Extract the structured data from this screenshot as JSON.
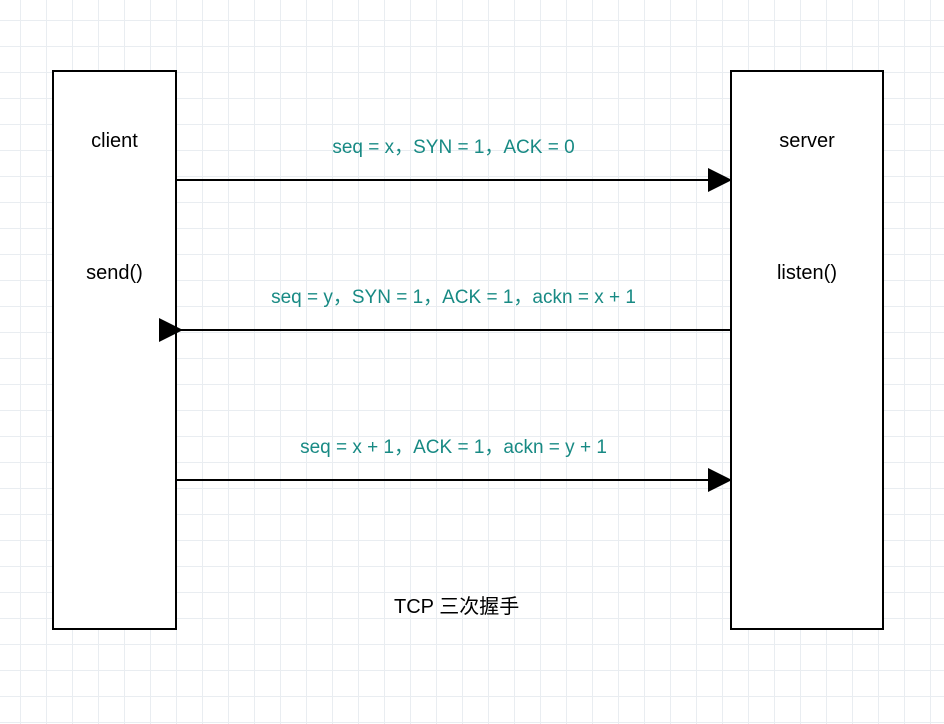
{
  "diagram": {
    "caption": "TCP 三次握手",
    "client": {
      "title": "client",
      "action": "send()"
    },
    "server": {
      "title": "server",
      "action": "listen()"
    },
    "messages": {
      "m1": {
        "label": "seq = x，SYN = 1，ACK = 0",
        "direction": "client-to-server"
      },
      "m2": {
        "label": "seq = y，SYN = 1，ACK = 1，ackn = x + 1",
        "direction": "server-to-client"
      },
      "m3": {
        "label": "seq = x + 1，ACK = 1，ackn = y + 1",
        "direction": "client-to-server"
      }
    },
    "colors": {
      "message_text": "#188a84"
    }
  }
}
